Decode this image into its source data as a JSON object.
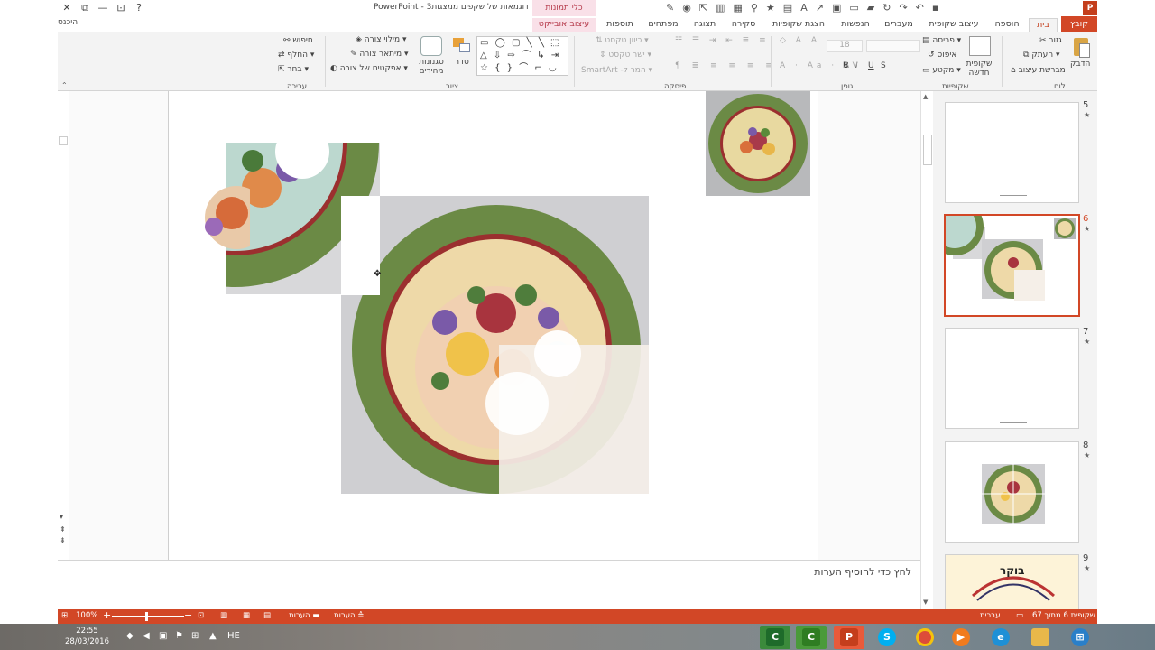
{
  "window": {
    "title": "דוגמאות של שקפים ממצגות3 - PowerPoint",
    "contextual_header": "כלי תמונות",
    "controls": {
      "close": "✕",
      "restore": "⧉",
      "minimize": "—",
      "ribbon_display": "⊡",
      "help": "?"
    }
  },
  "tabs": {
    "file": "קובץ",
    "home": "בית",
    "insert": "הוספה",
    "design": "עיצוב שקופית",
    "transitions": "מעברים",
    "animations": "הנפשות",
    "slideshow": "הצגת שקופיות",
    "review": "סקירה",
    "view": "תצוגה",
    "developer": "מפתחים",
    "addins": "תוספות",
    "format": "עיצוב אובייקט",
    "signin": "היכנס"
  },
  "ribbon": {
    "clipboard": {
      "paste": "הדבק",
      "cut": "גזור",
      "copy": "העתק",
      "format_painter": "מברשת עיצוב",
      "label": "לוח"
    },
    "slides": {
      "new_slide": "שקופית חדשה",
      "layout": "פריסה",
      "reset": "איפוס",
      "section": "מקטע",
      "label": "שקופיות"
    },
    "font": {
      "size": "18",
      "bold": "B",
      "italic": "I",
      "underline": "U",
      "strike": "S",
      "label": "גופן"
    },
    "paragraph": {
      "text_direction": "כיוון טקסט",
      "align_text": "ישר טקסט",
      "smartart": "המר ל- SmartArt",
      "label": "פיסקה"
    },
    "drawing": {
      "shapes_glyphs": "▭ ◯ ▢ ╲ ╲ ⬚ △ ⇩ ⇨ ⌒ ↳ ⇥ ☆ { } ⌒ ⌐ ◡",
      "arrange": "סדר",
      "quick_styles": "סגנונות מהירים",
      "shape_fill": "מילוי צורה",
      "shape_outline": "מיתאר צורה",
      "shape_effects": "אפקטים של צורה",
      "label": "ציור"
    },
    "editing": {
      "find": "חיפוש",
      "replace": "החלף",
      "select": "בחר",
      "label": "עריכה"
    }
  },
  "notes": {
    "placeholder": "לחץ כדי להוסיף הערות"
  },
  "thumbnails": [
    {
      "num": "5",
      "star": "★"
    },
    {
      "num": "6",
      "star": "★"
    },
    {
      "num": "7",
      "star": "★"
    },
    {
      "num": "8",
      "star": "★"
    },
    {
      "num": "9",
      "star": "★"
    }
  ],
  "thumb9_text": "בוקר",
  "statusbar": {
    "slide_info": "שקופית 6 מתוך 67",
    "language": "עברית",
    "notes": "הערות",
    "comments": "הערות",
    "zoom": "100%",
    "zoom_minus": "−",
    "zoom_plus": "+"
  },
  "taskbar": {
    "time": "22:55",
    "date": "28/03/2016",
    "lang": "HE"
  },
  "colors": {
    "accent": "#d24726",
    "ribbon_bg": "#f3f3f3",
    "context_tab": "#f9e0e8"
  }
}
